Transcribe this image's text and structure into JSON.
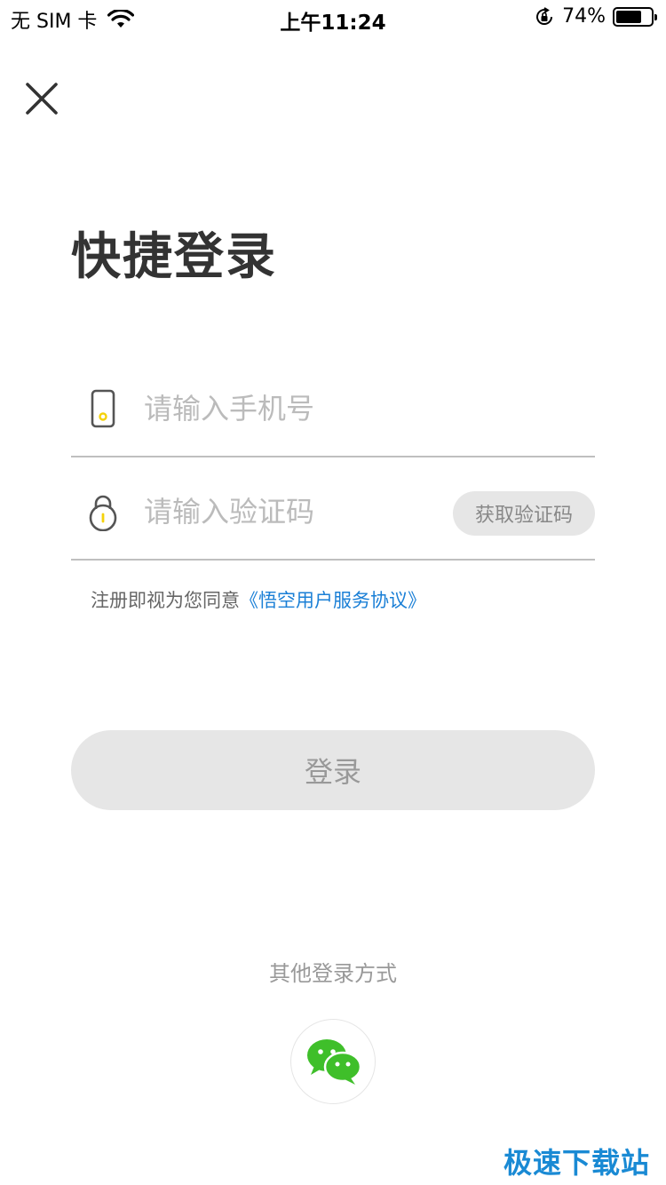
{
  "status_bar": {
    "carrier": "无 SIM 卡",
    "time": "上午11:24",
    "battery_percent": "74%",
    "battery_level": 0.74,
    "icons": [
      "wifi-icon",
      "orientation-lock-icon",
      "battery-icon"
    ]
  },
  "page": {
    "title": "快捷登录",
    "close_icon": "close-icon"
  },
  "form": {
    "phone": {
      "placeholder": "请输入手机号",
      "value": "",
      "icon": "phone-icon"
    },
    "code": {
      "placeholder": "请输入验证码",
      "value": "",
      "icon": "lock-icon"
    },
    "get_code_label": "获取验证码"
  },
  "agreement": {
    "prefix": "注册即视为您同意",
    "link_text": "《悟空用户服务协议》"
  },
  "login_label": "登录",
  "other_login": {
    "label": "其他登录方式",
    "wechat_icon": "wechat-icon"
  },
  "watermark": "极速下载站",
  "colors": {
    "accent_yellow": "#f5d20a",
    "link_blue": "#1a7fd6",
    "wechat_green": "#3fbf2a",
    "button_gray": "#e6e6e6"
  }
}
